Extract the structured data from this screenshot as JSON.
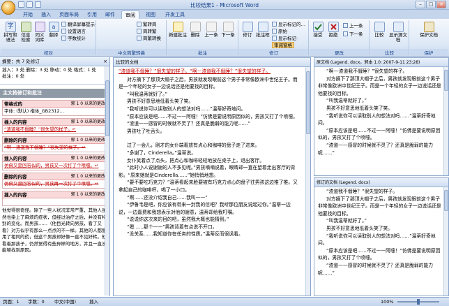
{
  "window": {
    "title": "比较结果1 - Microsoft Word",
    "min": "–",
    "max": "□",
    "close": "×"
  },
  "tabs": [
    "开始",
    "插入",
    "页面布局",
    "引用",
    "邮件",
    "审阅",
    "视图",
    "开发工具"
  ],
  "active_tab": "审阅",
  "ribbon": {
    "groups": [
      {
        "label": "校对",
        "buttons": [
          "拼写和语法",
          "信息检索",
          "同义词库",
          "翻译"
        ],
        "small": [
          "翻译屏幕提示·",
          "设置语言",
          "字数统计"
        ]
      },
      {
        "label": "中文简繁转换",
        "small": [
          "繁转简",
          "简转繁",
          "简繁转换"
        ]
      },
      {
        "label": "批注",
        "buttons": [
          "新建批注",
          "删除",
          "上一条",
          "下一条"
        ]
      },
      {
        "label": "修订",
        "buttons": [
          "修订",
          "批注框",
          "审阅窗格"
        ],
        "small": [
          "显示标记的…",
          "原始",
          "显示标记·"
        ]
      },
      {
        "label": "更改",
        "buttons": [
          "接受",
          "拒绝"
        ],
        "small": [
          "上一条",
          "下一条"
        ]
      },
      {
        "label": "比较",
        "buttons": [
          "比较",
          "显示源文档"
        ]
      },
      {
        "label": "保护",
        "buttons": [
          "保护文档"
        ]
      }
    ]
  },
  "left_pane": {
    "header": "摘要：共 7 处修订",
    "stats": [
      "插入：3 处  删除：3 处  移动：0 处  格式：1 处",
      "批注：0 处"
    ],
    "section_title": "主文档修订和批注",
    "cards": [
      {
        "type": "带格式的",
        "meta": "郭 1 0 以来的更改",
        "body": "字体: (默认) 楷体_GB2312…",
        "style": "plain"
      },
      {
        "type": "插入的内容",
        "meta": "郭 1 0 以来的更改",
        "body": "“渣道我不僭睡？”很失望的样子。↵",
        "style": "ins"
      },
      {
        "type": "删除的内容",
        "meta": "郭 1 0 以来的更改",
        "body": "“啊---渣道我不僭睡？”很失望的样子。↵",
        "style": "del"
      },
      {
        "type": "插入的内容",
        "meta": "郭 1 0 以来的更改",
        "body": "仿佛又是回答似的，男孩又一次打了个喷嚏。↵",
        "style": "ins"
      },
      {
        "type": "删除的内容",
        "meta": "郭 1 0 以来的更改",
        "body": "仿佛又是回答似的，男孩再一次打了个喷嚏。↵",
        "style": "del"
      },
      {
        "type": "插入的内容",
        "meta": "郭 1 0 以来的更改",
        "body": "",
        "style": "ins"
      }
    ],
    "tail_text": "他觉得很奇怪。除了一些人状况非常严重，其他人虽然也染上了麻烦的症状，但经过治疗之后，并没有特别的变化。而男孩……（他目光转向男孩，看了又看）对方似乎有那么一点点的不一样。其他的人都服用了相同的药，但这个男孩却好像一直不见好转。他看着那孩子，仍然觉得有些异样的地方，并且一直没能够找到原因。"
  },
  "mid_pane": {
    "header": "比较的文档",
    "first_line": "“渣道我不僭睡？”很失望的样子。“啊－渣道我不僭睡？”很失望的样子。",
    "paragraphs": [
      "对方摘下了那顶大帽子之后，男孩就发现眼前这个男子非常像欧洲中世纪王子。而是一个年轻的女子一边说话还是他要找的目标。",
      "“叫我温蒂就好了。”",
      "男孩不好意思地低着头笑了笑。",
      "“我听说你可以读取别人的想法对吗……”温蒂好奇地问。",
      "“原本应该是吧……不过——阿嚏！”仿佛是要说明原因似的，男孩又打了个喷嚏。",
      "“渣道——感冒的时候就不灵了？还真是脆弱的能力呢……”",
      "男孩吐了吐舌头。",
      "",
      "过了一会儿，刚才的女仆端着放有点心和咖啡的盘子走了进来。",
      "“多谢了，Cinderella。”温蒂说。",
      "女仆笑着点了点头，把点心和咖啡轻轻地放在桌子上，退出客厅。",
      "“此时小人说谢谢的人不多见呢。”男孩嘀嘀说着，眼睛却一直在望着走出客厅的背影。“原来她就是Cinderella……”她悄悄地想。",
      "“要不要吃巧克力？”温蒂看起来脸要被有巧克力点心的盘子往男孩这边推了推。又拿起自己的咖啡杯，喝了一小口。",
      "“啊……还没介绍我自己……我叫——”",
      "“伊鲁韦是吧，你应该有带来一封我的信吧？我听那位朋友说起过你。”温蒂一边说，一边嘉费和我想表示对他的谢意，温蒂却给我叮嘱。",
      "“说说你这次来的目的吧，虽然我大概也能猜到。”",
      "“嗯……那个——”男孩背着有点说不开口。",
      "“没关系……我知道你在任务的性质。”温蒂反而很讽看。"
    ]
  },
  "right_top": {
    "header": "原文档 (Legend. docx，郭本 1.0: 2007-9-11 23:28)",
    "paragraphs": [
      "“啊---渣道我不僭睡？”很失望的样子。",
      "对方摘下了那顶大帽子之后，男孩就发现眼前这个男子非常像欧洲中世纪王子。而是一个年轻的女子一边说话还是他要找的目标。",
      "“叫我温蒂就好了。”",
      "男孩不好意思地低着头笑了笑。",
      "“我听说你可以读取别人的想法对吗……”温蒂好奇地问。",
      "“原本应该是吧……不过——阿嚏！”仿佛是要说明原因似的，男孩又打了个喷嚏。",
      "“渣道——感冒的时候就不灵了？还真是脆弱的能力呢……”"
    ]
  },
  "right_bot": {
    "header": "修订的文档 (Legend. docx)",
    "paragraphs": [
      "“渣道我不僭睡？”很失望的样子。",
      "对方摘下了那顶大帽子之后，男孩就发现眼前这个男子非常像欧洲中世纪王子。而是一个年轻的女子一边说话还是他要找的目标。",
      "“叫我温蒂就好了。”",
      "男孩不好意思地低着头笑了笑。",
      "“我听说你可以读取别人的想法对吗……”温蒂好奇地问。",
      "“原本应该是吧……不过——阿嚏！”仿佛是要说明原因似的，男孩又打了个喷嚏。",
      "“渣道——感冒的时候就不灵了？还真是脆弱的能力呢……”"
    ]
  },
  "statusbar": {
    "page": "页面：1",
    "words": "字数：0",
    "language": "中文(中国)",
    "mode": "插入",
    "zoom": "100%"
  }
}
